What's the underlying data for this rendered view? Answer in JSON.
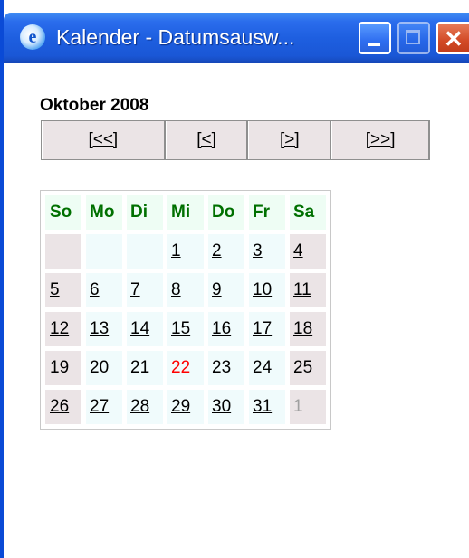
{
  "window": {
    "title": "Kalender - Datumsausw...",
    "icon": "ie-page-icon",
    "controls": [
      "minimize",
      "maximize",
      "close"
    ]
  },
  "calendar": {
    "month_label": "Oktober 2008",
    "nav": {
      "prev_year": "[<<]",
      "prev_month": "[<]",
      "next_month": "[>]",
      "next_year": "[>>]"
    },
    "weekdays": [
      "So",
      "Mo",
      "Di",
      "Mi",
      "Do",
      "Fr",
      "Sa"
    ],
    "today": "22",
    "weeks": [
      [
        "",
        "",
        "",
        "1",
        "2",
        "3",
        "4"
      ],
      [
        "5",
        "6",
        "7",
        "8",
        "9",
        "10",
        "11"
      ],
      [
        "12",
        "13",
        "14",
        "15",
        "16",
        "17",
        "18"
      ],
      [
        "19",
        "20",
        "21",
        "22",
        "23",
        "24",
        "25"
      ],
      [
        "26",
        "27",
        "28",
        "29",
        "30",
        "31",
        "1"
      ]
    ]
  },
  "colors": {
    "weekday_header": "#007000",
    "today": "#ff0000",
    "weekend_cell": "#ebe4e6",
    "weekday_cell": "#f0fbfc",
    "titlebar": "#1e5fe0"
  }
}
